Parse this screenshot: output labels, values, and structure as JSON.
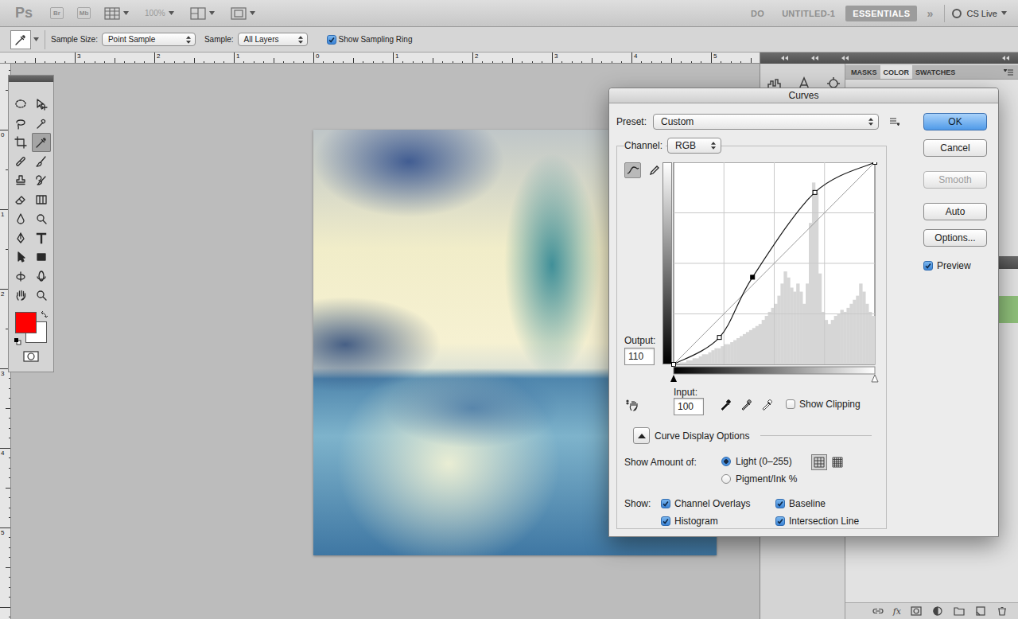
{
  "app_bar": {
    "logo": "Ps",
    "bridge": "Br",
    "mini_bridge": "Mb",
    "zoom": "100%",
    "zoom_disabled": true,
    "workspaces": [
      {
        "label": "DO",
        "selected": false
      },
      {
        "label": "UNTITLED-1",
        "selected": false
      },
      {
        "label": "ESSENTIALS",
        "selected": true
      }
    ],
    "more": "»",
    "cs_live": "CS Live"
  },
  "options_bar": {
    "sample_size_label": "Sample Size:",
    "sample_size": "Point Sample",
    "sample_label": "Sample:",
    "sample": "All Layers",
    "sampling_ring": {
      "label": "Show Sampling Ring",
      "checked": true
    }
  },
  "rulers": {
    "horizontal": [
      "3",
      "2",
      "1",
      "0",
      "1",
      "2",
      "3",
      "4",
      "5"
    ],
    "vertical": [
      "0",
      "1",
      "2",
      "3",
      "4",
      "5"
    ]
  },
  "tools": [
    {
      "selected": false
    },
    {
      "selected": false
    },
    {
      "selected": false
    },
    {
      "selected": false
    },
    {
      "selected": false
    },
    {
      "selected": true
    },
    {
      "selected": false
    },
    {
      "selected": false
    },
    {
      "selected": false
    },
    {
      "selected": false
    },
    {
      "selected": false
    },
    {
      "selected": false
    },
    {
      "selected": false
    },
    {
      "selected": false
    },
    {
      "selected": false
    },
    {
      "selected": false
    },
    {
      "selected": false
    },
    {
      "selected": false
    },
    {
      "selected": false
    },
    {
      "selected": false
    },
    {
      "selected": false
    },
    {
      "selected": false
    }
  ],
  "foreground_color": "#ff0000",
  "background_color": "#ffffff",
  "panels": {
    "tabs": [
      {
        "label": "MASKS",
        "selected": false
      },
      {
        "label": "COLOR",
        "selected": true
      },
      {
        "label": "SWATCHES",
        "selected": false
      }
    ],
    "footer_label": "fx"
  },
  "curves": {
    "title": "Curves",
    "preset_label": "Preset:",
    "preset": "Custom",
    "channel_label": "Channel:",
    "channel": "RGB",
    "edit_modes": [
      {
        "selected": true
      },
      {
        "selected": false
      }
    ],
    "output_label": "Output:",
    "output": "110",
    "input_label": "Input:",
    "input": "100",
    "show_clipping": {
      "label": "Show Clipping",
      "checked": false
    },
    "display_options": {
      "label": "Curve Display Options",
      "expanded": true
    },
    "show_amount_label": "Show Amount of:",
    "amount_options": [
      {
        "label": "Light (0–255)",
        "selected": true
      },
      {
        "label": "Pigment/Ink %",
        "selected": false
      }
    ],
    "grid_options": [
      {
        "selected": true
      },
      {
        "selected": false
      }
    ],
    "show_label": "Show:",
    "show_options": [
      {
        "label": "Channel Overlays",
        "checked": true
      },
      {
        "label": "Baseline",
        "checked": true
      },
      {
        "label": "Histogram",
        "checked": true
      },
      {
        "label": "Intersection Line",
        "checked": true
      }
    ],
    "buttons": [
      {
        "label": "OK",
        "default": true,
        "disabled": false
      },
      {
        "label": "Cancel",
        "default": false,
        "disabled": false
      },
      {
        "label": "Smooth",
        "default": false,
        "disabled": true
      },
      {
        "label": "Auto",
        "default": false,
        "disabled": false
      },
      {
        "label": "Options...",
        "default": false,
        "disabled": false
      }
    ],
    "preview": {
      "label": "Preview",
      "checked": true
    },
    "points": [
      {
        "input": 0,
        "output": 0,
        "selected": false
      },
      {
        "input": 58,
        "output": 34,
        "selected": false
      },
      {
        "input": 100,
        "output": 110,
        "selected": true
      },
      {
        "input": 179,
        "output": 217,
        "selected": false
      },
      {
        "input": 255,
        "output": 255,
        "selected": false
      }
    ],
    "histogram": [
      0,
      0,
      1,
      1,
      2,
      2,
      3,
      3,
      4,
      5,
      5,
      6,
      7,
      8,
      8,
      9,
      10,
      10,
      11,
      12,
      13,
      14,
      15,
      16,
      17,
      18,
      19,
      20,
      22,
      24,
      26,
      28,
      30,
      34,
      40,
      46,
      43,
      38,
      36,
      40,
      36,
      30,
      40,
      70,
      90,
      85,
      45,
      26,
      22,
      20,
      22,
      24,
      25,
      27,
      26,
      28,
      30,
      32,
      34,
      40,
      36,
      30,
      26,
      24
    ]
  }
}
